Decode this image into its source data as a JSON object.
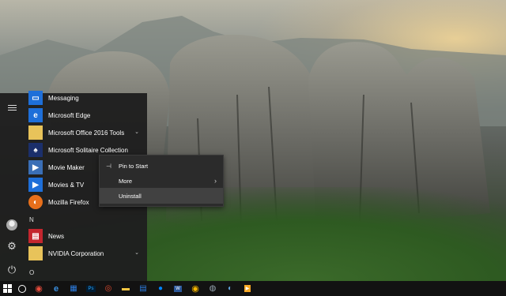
{
  "start_menu": {
    "apps": [
      {
        "label": "Messaging",
        "icon": "messaging-icon",
        "color": "#1e6fd9",
        "has_chevron": false
      },
      {
        "label": "Microsoft Edge",
        "icon": "edge-icon",
        "color": "#1e6fd9",
        "has_chevron": false
      },
      {
        "label": "Microsoft Office 2016 Tools",
        "icon": "folder-icon",
        "color": "#e8c35a",
        "has_chevron": true
      },
      {
        "label": "Microsoft Solitaire Collection",
        "icon": "solitaire-icon",
        "color": "#1b2f6b",
        "has_chevron": false
      },
      {
        "label": "Movie Maker",
        "icon": "movie-maker-icon",
        "color": "#3a6fb6",
        "has_chevron": false
      },
      {
        "label": "Movies & TV",
        "icon": "movies-tv-icon",
        "color": "#1e6fd9",
        "has_chevron": false
      },
      {
        "label": "Mozilla Firefox",
        "icon": "firefox-icon",
        "color": "#e76f1b",
        "has_chevron": false
      },
      {
        "label": "News",
        "icon": "news-icon",
        "color": "#c4262e",
        "has_chevron": false
      },
      {
        "label": "NVIDIA Corporation",
        "icon": "folder-icon",
        "color": "#e8c35a",
        "has_chevron": true
      }
    ],
    "letters": {
      "n": "N",
      "o": "O"
    }
  },
  "context_menu": {
    "pin_label": "Pin to Start",
    "more_label": "More",
    "uninstall_label": "Uninstall"
  },
  "taskbar": {
    "items": [
      "start-icon",
      "cortana-icon",
      "chrome-icon",
      "edge-icon",
      "store-icon",
      "photoshop-icon",
      "app-icon",
      "explorer-icon",
      "store-icon",
      "messenger-icon",
      "word-icon",
      "chrome-icon",
      "steam-icon",
      "app-icon",
      "media-player-icon"
    ]
  },
  "colors": {
    "accent": "#76b9ed",
    "menu_bg": "#1f1f1f",
    "context_bg": "#2b2b2b"
  }
}
